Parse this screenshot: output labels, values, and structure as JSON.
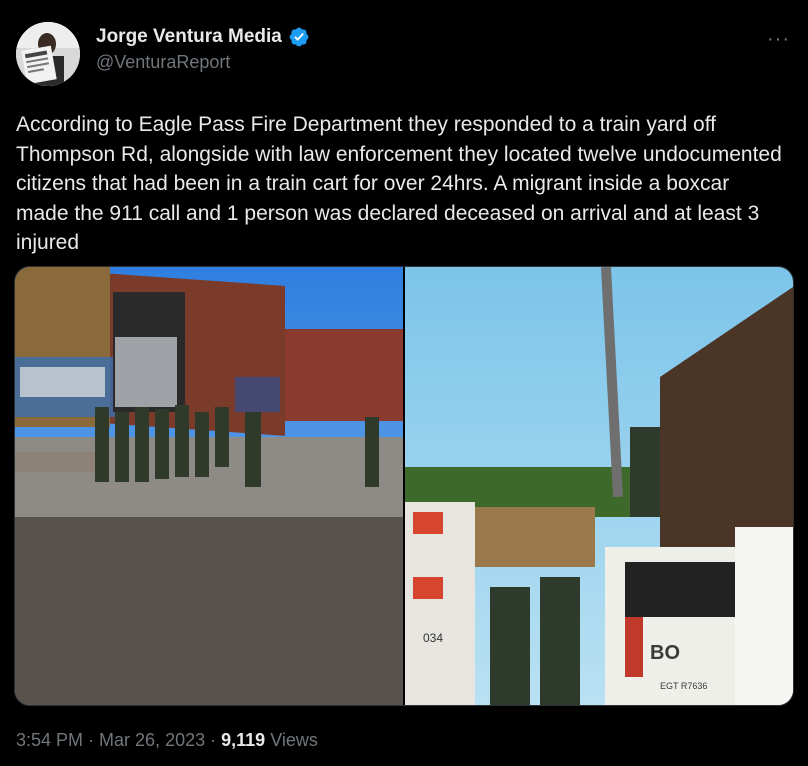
{
  "author": {
    "display_name": "Jorge Ventura Media",
    "handle": "@VenturaReport",
    "verified_icon": "verified-badge-icon",
    "accent": "#1d9bf0"
  },
  "more_label": "···",
  "tweet": {
    "text": "According to Eagle Pass Fire Department they responded to a train yard off Thompson Rd, alongside with law enforcement they located twelve undocumented citizens that had been in a train cart for over 24hrs. A migrant inside a boxcar made the 911 call and 1 person was declared deceased on arrival and at least 3 injured"
  },
  "photos": {
    "right": {
      "truck_number": "034",
      "truck_panel": "BO",
      "plate": "EGT R7636"
    }
  },
  "meta": {
    "time": "3:54 PM",
    "sep1": " · ",
    "date": "Mar 26, 2023",
    "sep2": " · ",
    "views_count": "9,119",
    "views_label": " Views"
  }
}
